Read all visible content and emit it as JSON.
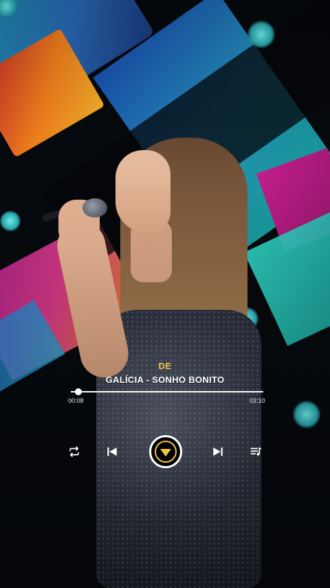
{
  "track": {
    "artist": "DE",
    "title": "GALÍCIA - SONHO BONITO",
    "current_time": "00:08",
    "total_time": "03:10",
    "progress": 0.04
  },
  "controls": {
    "repeat": "repeat-icon",
    "previous": "skip-previous-icon",
    "play": "play-icon",
    "next": "skip-next-icon",
    "queue": "playlist-icon"
  },
  "colors": {
    "accent": "#f5c542",
    "text": "#ffffff"
  }
}
